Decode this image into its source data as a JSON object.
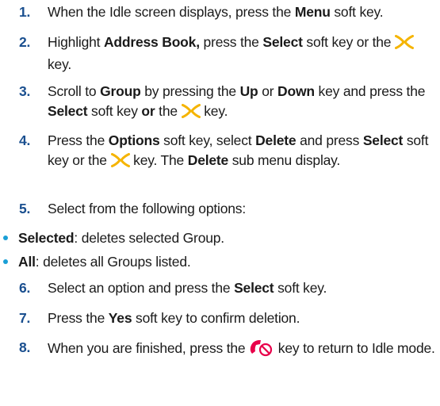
{
  "steps": [
    {
      "num": "1.",
      "parts": [
        "When the Idle screen displays, press the ",
        "Menu",
        " soft key."
      ]
    },
    {
      "num": "2.",
      "parts": [
        "Highlight ",
        "Address Book,",
        " press the ",
        "Select",
        " soft key or the ",
        " key."
      ]
    },
    {
      "num": "3.",
      "parts": [
        "Scroll to ",
        "Group",
        " by pressing the ",
        "Up",
        " or ",
        "Down",
        " key and press the ",
        "Select",
        " soft key ",
        "or",
        " the ",
        " key."
      ]
    },
    {
      "num": "4.",
      "parts": [
        "Press the ",
        "Options",
        " soft key, select ",
        "Delete",
        " and press ",
        "Select",
        " soft key or the ",
        " key. The ",
        "Delete",
        " sub menu display."
      ]
    },
    {
      "num": "5.",
      "parts": [
        "Select from the following options:"
      ]
    },
    {
      "num": "6.",
      "parts": [
        "Select an option and press the ",
        "Select",
        " soft key."
      ]
    },
    {
      "num": "7.",
      "parts": [
        "Press the ",
        "Yes",
        " soft key to confirm deletion."
      ]
    },
    {
      "num": "8.",
      "parts": [
        "When you are finished, press the ",
        " key to return to Idle mode."
      ]
    }
  ],
  "options": [
    {
      "label": "Selected",
      "desc": ": deletes selected Group."
    },
    {
      "label": "All",
      "desc": ": deletes all Groups listed."
    }
  ],
  "icons": {
    "nav_key": "nav-key-icon",
    "end_key": "end-call-key-icon",
    "nav_key_color": "#f5b400",
    "end_key_color": "#e8004a"
  },
  "colors": {
    "step_number": "#1a4f8f",
    "bullet": "#1a9fd6"
  }
}
